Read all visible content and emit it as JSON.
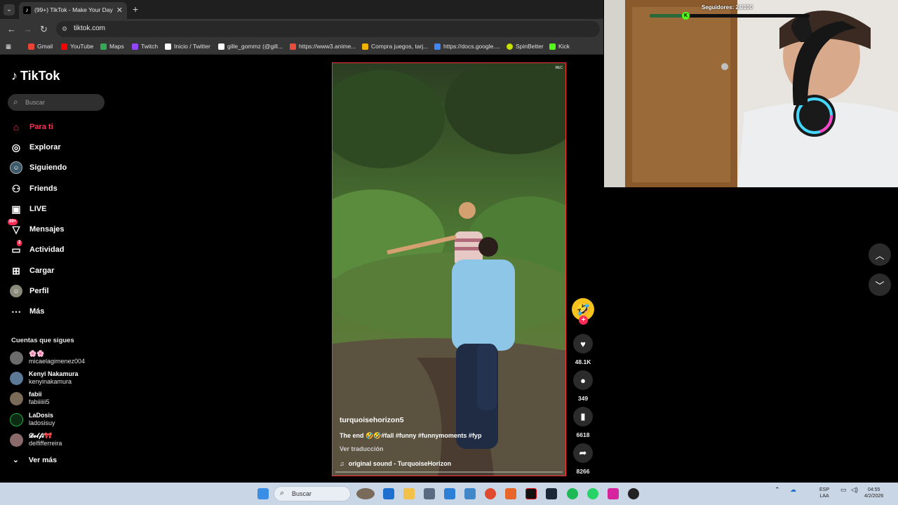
{
  "browser": {
    "tab_title": "(99+) TikTok - Make Your Day",
    "tab_close": "✕",
    "new_tab": "+",
    "url": "tiktok.com",
    "bookmarks": [
      {
        "label": "Gmail",
        "color": "#ea4335"
      },
      {
        "label": "YouTube",
        "color": "#ff0000"
      },
      {
        "label": "Maps",
        "color": "#34a853"
      },
      {
        "label": "Twitch",
        "color": "#9146ff"
      },
      {
        "label": "Inicio / Twitter",
        "color": "#ffffff"
      },
      {
        "label": "gille_gommz (@gill...",
        "color": "#ffffff"
      },
      {
        "label": "https://www3.anime...",
        "color": "#e94e3c"
      },
      {
        "label": "Compra juegos, tarj...",
        "color": "#f0b400"
      },
      {
        "label": "https://docs.google....",
        "color": "#4285f4"
      },
      {
        "label": "SpinBetter",
        "color": "#c6e000"
      },
      {
        "label": "Kick",
        "color": "#53fc18"
      }
    ]
  },
  "sidebar": {
    "logo": "TikTok",
    "search_placeholder": "Buscar",
    "nav": [
      {
        "label": "Para ti",
        "icon": "home-icon"
      },
      {
        "label": "Explorar",
        "icon": "compass-icon"
      },
      {
        "label": "Siguiendo",
        "icon": "following-icon"
      },
      {
        "label": "Friends",
        "icon": "friends-icon"
      },
      {
        "label": "LIVE",
        "icon": "live-icon"
      },
      {
        "label": "Mensajes",
        "icon": "messages-icon",
        "badge": "99+"
      },
      {
        "label": "Actividad",
        "icon": "activity-icon",
        "badge": "2"
      },
      {
        "label": "Cargar",
        "icon": "upload-icon"
      },
      {
        "label": "Perfil",
        "icon": "profile-icon"
      },
      {
        "label": "Más",
        "icon": "more-icon"
      }
    ],
    "following_title": "Cuentas que sigues",
    "accounts": [
      {
        "name": "🌸🌸",
        "handle": "micaelagimenez004"
      },
      {
        "name": "Kenyi Nakamura",
        "handle": "kenyinakamura"
      },
      {
        "name": "fabii",
        "handle": "fabiiiiii5"
      },
      {
        "name": "LaDosis",
        "handle": "ladosisuy"
      },
      {
        "name": "𝓓𝓮𝓵𝓯𝓲🎀",
        "handle": "delfifferreira"
      }
    ],
    "see_more": "Ver más"
  },
  "video": {
    "username": "turquoisehorizon5",
    "caption": "The end 🤣🤣#fall #funny #funnymoments #fyp",
    "translate": "Ver traducción",
    "sound": "original sound - TurquoiseHorizon",
    "rec": "REC"
  },
  "actions": {
    "likes": "48.1K",
    "comments": "349",
    "saves": "6618",
    "shares": "8266"
  },
  "overlay": {
    "followers_text": "Seguidores: 24/100",
    "followers_progress": 0.24
  },
  "taskbar": {
    "search_label": "Buscar",
    "lang": "ESP",
    "region": "LAA",
    "time": "04:55",
    "date": "4/2/2026"
  }
}
